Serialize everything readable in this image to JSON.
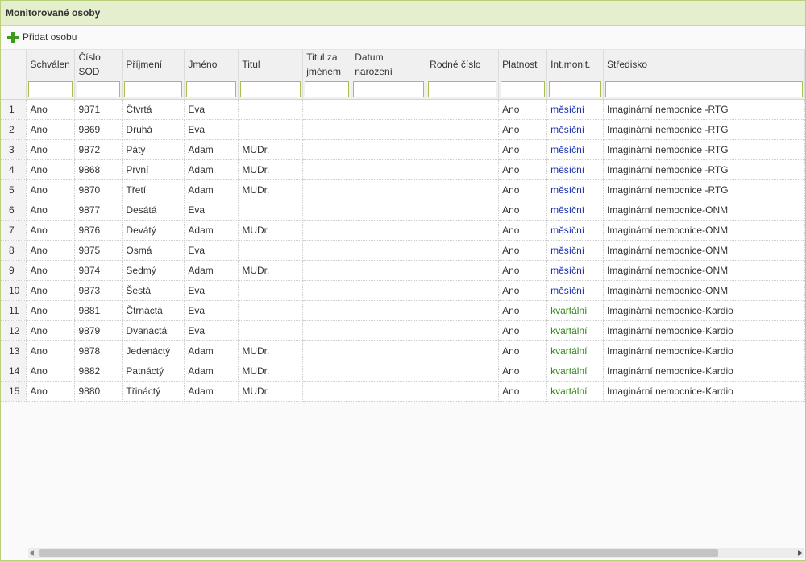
{
  "panel": {
    "title": "Monitorované osoby"
  },
  "toolbar": {
    "add_label": "Přidat osobu"
  },
  "columns": [
    "Schválen",
    "Číslo SOD",
    "Příjmení",
    "Jméno",
    "Titul",
    "Titul za jménem",
    "Datum narození",
    "Rodné číslo",
    "Platnost",
    "Int.monit.",
    "Středisko"
  ],
  "rows": [
    {
      "n": "1",
      "approved": "Ano",
      "sod": "9871",
      "surname": "Čtvrtá",
      "name": "Eva",
      "title": "",
      "title_after": "",
      "birth": "",
      "rc": "",
      "valid": "Ano",
      "interval": "měsíční",
      "center": "Imaginární nemocnice -RTG"
    },
    {
      "n": "2",
      "approved": "Ano",
      "sod": "9869",
      "surname": "Druhá",
      "name": "Eva",
      "title": "",
      "title_after": "",
      "birth": "",
      "rc": "",
      "valid": "Ano",
      "interval": "měsíční",
      "center": "Imaginární nemocnice -RTG"
    },
    {
      "n": "3",
      "approved": "Ano",
      "sod": "9872",
      "surname": "Pátý",
      "name": "Adam",
      "title": "MUDr.",
      "title_after": "",
      "birth": "",
      "rc": "",
      "valid": "Ano",
      "interval": "měsíční",
      "center": "Imaginární nemocnice -RTG"
    },
    {
      "n": "4",
      "approved": "Ano",
      "sod": "9868",
      "surname": "První",
      "name": "Adam",
      "title": "MUDr.",
      "title_after": "",
      "birth": "",
      "rc": "",
      "valid": "Ano",
      "interval": "měsíční",
      "center": "Imaginární nemocnice -RTG"
    },
    {
      "n": "5",
      "approved": "Ano",
      "sod": "9870",
      "surname": "Třetí",
      "name": "Adam",
      "title": "MUDr.",
      "title_after": "",
      "birth": "",
      "rc": "",
      "valid": "Ano",
      "interval": "měsíční",
      "center": "Imaginární nemocnice -RTG"
    },
    {
      "n": "6",
      "approved": "Ano",
      "sod": "9877",
      "surname": "Desátá",
      "name": "Eva",
      "title": "",
      "title_after": "",
      "birth": "",
      "rc": "",
      "valid": "Ano",
      "interval": "měsíční",
      "center": "Imaginární nemocnice-ONM"
    },
    {
      "n": "7",
      "approved": "Ano",
      "sod": "9876",
      "surname": "Devátý",
      "name": "Adam",
      "title": "MUDr.",
      "title_after": "",
      "birth": "",
      "rc": "",
      "valid": "Ano",
      "interval": "měsíční",
      "center": "Imaginární nemocnice-ONM"
    },
    {
      "n": "8",
      "approved": "Ano",
      "sod": "9875",
      "surname": "Osmá",
      "name": "Eva",
      "title": "",
      "title_after": "",
      "birth": "",
      "rc": "",
      "valid": "Ano",
      "interval": "měsíční",
      "center": "Imaginární nemocnice-ONM"
    },
    {
      "n": "9",
      "approved": "Ano",
      "sod": "9874",
      "surname": "Sedmý",
      "name": "Adam",
      "title": "MUDr.",
      "title_after": "",
      "birth": "",
      "rc": "",
      "valid": "Ano",
      "interval": "měsíční",
      "center": "Imaginární nemocnice-ONM"
    },
    {
      "n": "10",
      "approved": "Ano",
      "sod": "9873",
      "surname": "Šestá",
      "name": "Eva",
      "title": "",
      "title_after": "",
      "birth": "",
      "rc": "",
      "valid": "Ano",
      "interval": "měsíční",
      "center": "Imaginární nemocnice-ONM"
    },
    {
      "n": "11",
      "approved": "Ano",
      "sod": "9881",
      "surname": "Čtrnáctá",
      "name": "Eva",
      "title": "",
      "title_after": "",
      "birth": "",
      "rc": "",
      "valid": "Ano",
      "interval": "kvartální",
      "center": "Imaginární nemocnice-Kardio"
    },
    {
      "n": "12",
      "approved": "Ano",
      "sod": "9879",
      "surname": "Dvanáctá",
      "name": "Eva",
      "title": "",
      "title_after": "",
      "birth": "",
      "rc": "",
      "valid": "Ano",
      "interval": "kvartální",
      "center": "Imaginární nemocnice-Kardio"
    },
    {
      "n": "13",
      "approved": "Ano",
      "sod": "9878",
      "surname": "Jedenáctý",
      "name": "Adam",
      "title": "MUDr.",
      "title_after": "",
      "birth": "",
      "rc": "",
      "valid": "Ano",
      "interval": "kvartální",
      "center": "Imaginární nemocnice-Kardio"
    },
    {
      "n": "14",
      "approved": "Ano",
      "sod": "9882",
      "surname": "Patnáctý",
      "name": "Adam",
      "title": "MUDr.",
      "title_after": "",
      "birth": "",
      "rc": "",
      "valid": "Ano",
      "interval": "kvartální",
      "center": "Imaginární nemocnice-Kardio"
    },
    {
      "n": "15",
      "approved": "Ano",
      "sod": "9880",
      "surname": "Třináctý",
      "name": "Adam",
      "title": "MUDr.",
      "title_after": "",
      "birth": "",
      "rc": "",
      "valid": "Ano",
      "interval": "kvartální",
      "center": "Imaginární nemocnice-Kardio"
    }
  ],
  "colors": {
    "monthly": "#1a2fb0",
    "quarterly": "#2e8b12",
    "header_bg": "#e6efcd",
    "accent": "#a6c24a"
  },
  "icons": {
    "add": "plus-icon"
  }
}
